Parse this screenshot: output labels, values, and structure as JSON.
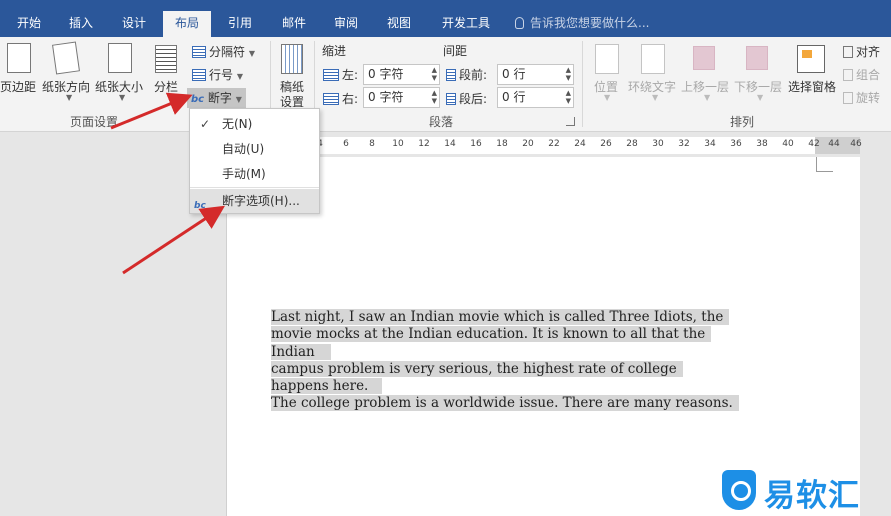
{
  "tabs": [
    "开始",
    "插入",
    "设计",
    "布局",
    "引用",
    "邮件",
    "审阅",
    "视图",
    "开发工具"
  ],
  "active_tab": "布局",
  "tell_me": "告诉我您想要做什么...",
  "page_setup": {
    "margins": "页边距",
    "orientation": "纸张方向",
    "size": "纸张大小",
    "columns": "分栏",
    "breaks": "分隔符",
    "line_numbers": "行号",
    "hyphenation": "断字",
    "label": "页面设置"
  },
  "draft": {
    "line1": "稿纸",
    "line2": "设置"
  },
  "paragraph": {
    "indent_title": "缩进",
    "spacing_title": "间距",
    "left_label": "左:",
    "left_value": "0 字符",
    "right_label": "右:",
    "right_value": "0 字符",
    "before_label": "段前:",
    "before_value": "0 行",
    "after_label": "段后:",
    "after_value": "0 行",
    "label": "段落"
  },
  "arrange": {
    "position": "位置",
    "wrap_text": "环绕文字",
    "bring_forward": "上移一层",
    "send_backward": "下移一层",
    "selection_pane": "选择窗格",
    "align": "对齐",
    "group": "组合",
    "rotate": "旋转",
    "label": "排列"
  },
  "hyphen_menu": {
    "none": "无(N)",
    "auto": "自动(U)",
    "manual": "手动(M)",
    "options": "断字选项(H)..."
  },
  "ruler_ticks": [
    "4",
    "6",
    "8",
    "10",
    "12",
    "14",
    "16",
    "18",
    "20",
    "22",
    "24",
    "26",
    "28",
    "30",
    "32",
    "34",
    "36",
    "38",
    "40",
    "42",
    "44",
    "46"
  ],
  "document_lines": [
    "Last night, I saw an Indian movie which is called Three Idiots, the",
    "movie mocks at the Indian education. It is known to all that the",
    "Indian",
    "campus problem is very serious, the highest rate of college",
    "happens here.",
    "The college problem is a worldwide issue. There are many reasons."
  ],
  "watermark": "易软汇",
  "colors": {
    "accent": "#2b579a",
    "arrow": "#d42a2a",
    "highlight": "#d6d6d6",
    "watermark": "#1d8fe6"
  }
}
